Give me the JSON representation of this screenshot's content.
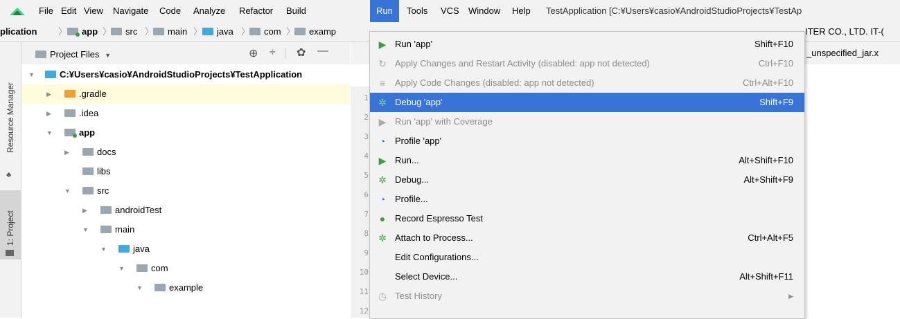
{
  "menubar": {
    "items": [
      {
        "label": "File"
      },
      {
        "label": "Edit"
      },
      {
        "label": "View"
      },
      {
        "label": "Navigate"
      },
      {
        "label": "Code"
      },
      {
        "label": "Analyze"
      },
      {
        "label": "Refactor"
      },
      {
        "label": "Build"
      },
      {
        "label": "Run"
      },
      {
        "label": "Tools"
      },
      {
        "label": "VCS"
      },
      {
        "label": "Window"
      },
      {
        "label": "Help"
      }
    ],
    "title": "TestApplication [C:¥Users¥casio¥AndroidStudioProjects¥TestAp"
  },
  "breadcrumb": {
    "items": [
      "plication",
      "app",
      "src",
      "main",
      "java",
      "com",
      "examp"
    ],
    "right_text": "ITER CO., LTD. IT-("
  },
  "leftstrip": {
    "resource_manager": "Resource Manager",
    "project": "1: Project"
  },
  "project_panel": {
    "title": "Project Files",
    "tree": [
      {
        "label": "C:¥Users¥casio¥AndroidStudioProjects¥TestApplication"
      },
      {
        "label": ".gradle"
      },
      {
        "label": ".idea"
      },
      {
        "label": "app"
      },
      {
        "label": "docs"
      },
      {
        "label": "libs"
      },
      {
        "label": "src"
      },
      {
        "label": "androidTest"
      },
      {
        "label": "main"
      },
      {
        "label": "java"
      },
      {
        "label": "com"
      },
      {
        "label": "example"
      }
    ]
  },
  "editor": {
    "tab_text": "_unspecified_jar.x",
    "line_numbers": [
      "1",
      "2",
      "3",
      "4",
      "5",
      "6",
      "7",
      "8",
      "9",
      "10",
      "11",
      "12"
    ]
  },
  "run_menu": {
    "items": [
      {
        "label": "Run 'app'",
        "shortcut": "Shift+F10",
        "icon": "run-icon"
      },
      {
        "label": "Apply Changes and Restart Activity (disabled: app not detected)",
        "shortcut": "Ctrl+F10",
        "icon": "apply-changes-icon"
      },
      {
        "label": "Apply Code Changes (disabled: app not detected)",
        "shortcut": "Ctrl+Alt+F10",
        "icon": "apply-code-icon"
      },
      {
        "label": "Debug 'app'",
        "shortcut": "Shift+F9",
        "icon": "debug-icon"
      },
      {
        "label": "Run 'app' with Coverage",
        "shortcut": "",
        "icon": "coverage-icon"
      },
      {
        "label": "Profile 'app'",
        "shortcut": "",
        "icon": "profile-icon"
      },
      {
        "label": "Run...",
        "shortcut": "Alt+Shift+F10",
        "icon": "run-icon"
      },
      {
        "label": "Debug...",
        "shortcut": "Alt+Shift+F9",
        "icon": "debug-icon"
      },
      {
        "label": "Profile...",
        "shortcut": "",
        "icon": "profile-icon"
      },
      {
        "label": "Record Espresso Test",
        "shortcut": "",
        "icon": "espresso-icon"
      },
      {
        "label": "Attach to Process...",
        "shortcut": "Ctrl+Alt+F5",
        "icon": "attach-icon"
      },
      {
        "label": "Edit Configurations...",
        "shortcut": "",
        "icon": ""
      },
      {
        "label": "Select Device...",
        "shortcut": "Alt+Shift+F11",
        "icon": ""
      },
      {
        "label": "Test History",
        "shortcut": "",
        "icon": "history-icon"
      }
    ]
  },
  "colors": {
    "accent": "#3874d8",
    "run_green": "#3e9c3e",
    "highlight_row": "#fffbdc"
  }
}
